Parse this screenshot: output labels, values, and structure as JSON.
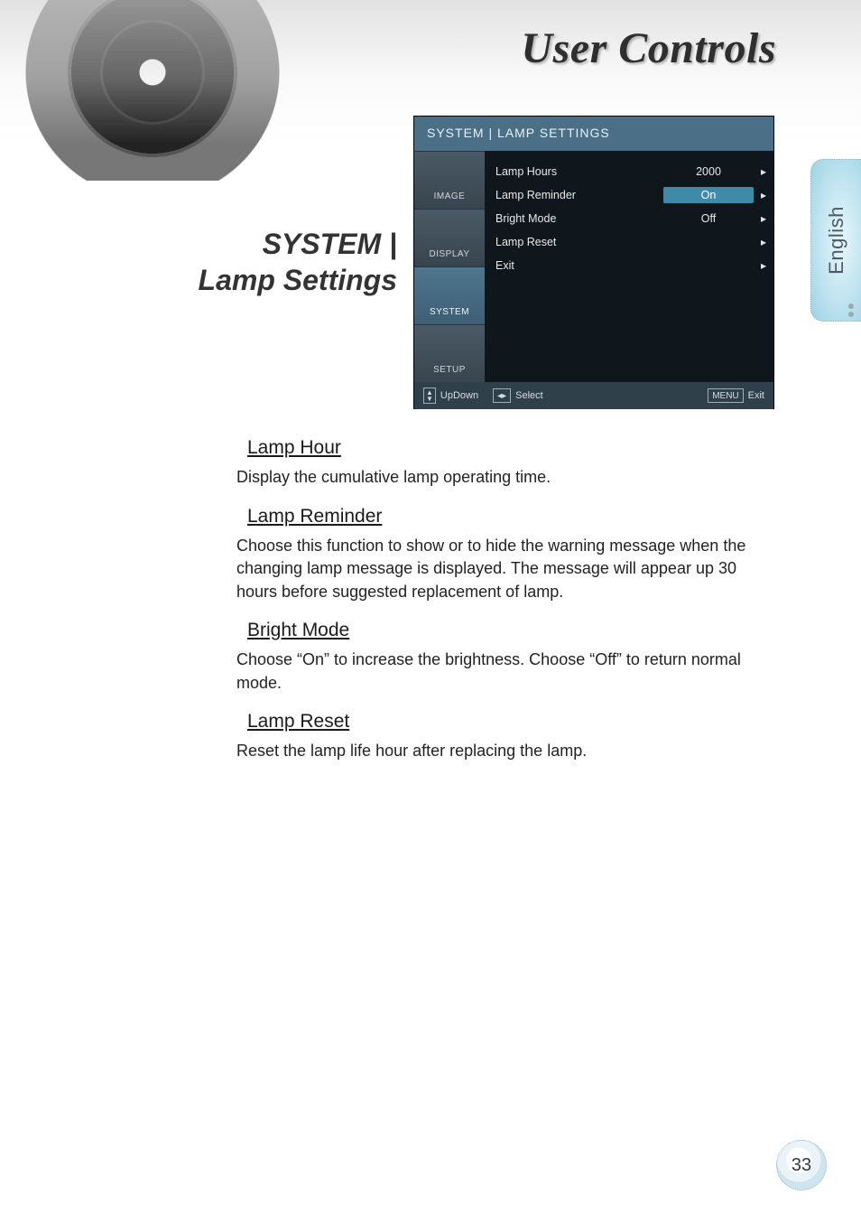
{
  "chapter_title": "User Controls",
  "section_heading_line1": "SYSTEM |",
  "section_heading_line2": "Lamp Settings",
  "language_tab": "English",
  "page_number": "33",
  "osd": {
    "title": "SYSTEM | LAMP SETTINGS",
    "tabs": [
      "IMAGE",
      "DISPLAY",
      "SYSTEM",
      "SETUP"
    ],
    "active_tab_index": 2,
    "rows": [
      {
        "label": "Lamp Hours",
        "value": "2000",
        "highlighted": false
      },
      {
        "label": "Lamp Reminder",
        "value": "On",
        "highlighted": true
      },
      {
        "label": "Bright Mode",
        "value": "Off",
        "highlighted": false
      },
      {
        "label": "Lamp Reset",
        "value": "",
        "highlighted": false
      },
      {
        "label": "Exit",
        "value": "",
        "highlighted": false
      }
    ],
    "footer": {
      "updown": "UpDown",
      "select": "Select",
      "menu_key": "MENU",
      "exit": "Exit"
    }
  },
  "sections": [
    {
      "heading": "Lamp Hour",
      "body": "Display the cumulative lamp operating time."
    },
    {
      "heading": "Lamp Reminder",
      "body": "Choose this function to show or to hide the warning message when the changing lamp message is displayed. The message will appear up 30 hours before suggested replacement of lamp."
    },
    {
      "heading": "Bright Mode",
      "body": "Choose “On” to increase the brightness. Choose “Off” to return normal mode."
    },
    {
      "heading": "Lamp Reset",
      "body": "Reset the lamp life hour after replacing the lamp."
    }
  ]
}
